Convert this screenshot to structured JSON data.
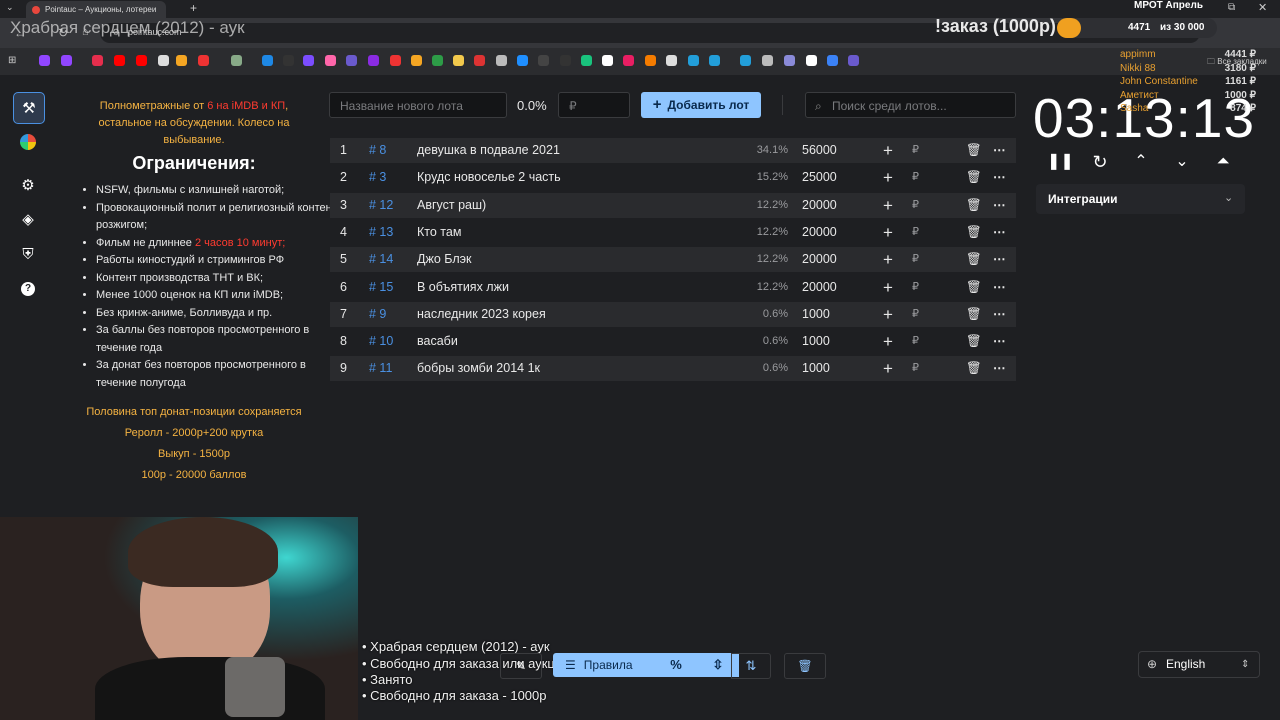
{
  "browser": {
    "tab_title": "Pointauc – Аукционы, лотереи",
    "url": "pointauc.com",
    "bookmarks_folder": "Все закладки"
  },
  "stream_overlay": {
    "title": "Храбрая сердцем (2012) - аук",
    "order_label": "!заказ (1000р)",
    "goal_label": "МРОТ Апрель",
    "goal_current": "4471",
    "goal_target": "из 30 000",
    "goal_progress": 0.149,
    "donors": [
      {
        "name": "appimm",
        "amount": "4441 ₽",
        "color": "#e8a030"
      },
      {
        "name": "Nikki 88",
        "amount": "3180 ₽",
        "color": "#e8a030"
      },
      {
        "name": "John Constantine",
        "amount": "1161 ₽",
        "color": "#e8a030"
      },
      {
        "name": "Аметист",
        "amount": "1000 ₽",
        "color": "#e8a030"
      },
      {
        "name": "Sasha",
        "amount": "874 ₽",
        "color": "#e8a030"
      }
    ],
    "bottom_lines": [
      "• Храбрая сердцем (2012) - аук",
      "• Свободно для заказа или аукциона",
      "• Занято",
      "• Свободно для заказа - 1000р"
    ]
  },
  "rules": {
    "intro_pre": "Полнометражные от ",
    "intro_red": "6 на iMDB и КП",
    "intro_post": ", остальное на обсуждении. Колесо на выбывание.",
    "heading": "Ограничения:",
    "items": [
      "NSFW, фильмы с излишней наготой;",
      "Провокационный полит и религиозный контент с розжигом;",
      "Фильм не длиннее ",
      "Работы киностудий и стримингов РФ",
      "Контент производства ТНТ и ВК;",
      "Менее 1000 оценок на КП или iMDB;",
      "Без кринж-аниме, Болливуда и пр.",
      "За баллы без повторов просмотренного в течение года",
      "За донат без повторов просмотренного в течение полугода"
    ],
    "item3_red": "2 часов 10 минут;",
    "footer": [
      "Половина топ донат-позиции сохраняется",
      "Реролл - 2000р+200 крутка",
      "Выкуп - 1500р",
      "100р - 20000 баллов"
    ]
  },
  "toolbar": {
    "lot_name_placeholder": "Название нового лота",
    "percent": "0.0%",
    "amount_placeholder": "₽",
    "add_button": "Добавить лот",
    "search_placeholder": "Поиск среди лотов..."
  },
  "lots": [
    {
      "pos": "1",
      "id": "# 8",
      "name": "девушка в подвале 2021",
      "pct": "34.1%",
      "amount": "56000"
    },
    {
      "pos": "2",
      "id": "# 3",
      "name": "Крудс новоселье 2 часть",
      "pct": "15.2%",
      "amount": "25000"
    },
    {
      "pos": "3",
      "id": "# 12",
      "name": "Август раш)",
      "pct": "12.2%",
      "amount": "20000"
    },
    {
      "pos": "4",
      "id": "# 13",
      "name": "Кто там",
      "pct": "12.2%",
      "amount": "20000"
    },
    {
      "pos": "5",
      "id": "# 14",
      "name": "Джо Блэк",
      "pct": "12.2%",
      "amount": "20000"
    },
    {
      "pos": "6",
      "id": "# 15",
      "name": "В объятиях лжи",
      "pct": "12.2%",
      "amount": "20000"
    },
    {
      "pos": "7",
      "id": "# 9",
      "name": "наследник 2023 корея",
      "pct": "0.6%",
      "amount": "1000"
    },
    {
      "pos": "8",
      "id": "# 10",
      "name": "васаби",
      "pct": "0.6%",
      "amount": "1000"
    },
    {
      "pos": "9",
      "id": "# 11",
      "name": "бобры зомби 2014 1к",
      "pct": "0.6%",
      "amount": "1000"
    }
  ],
  "lot_currency": "₽",
  "timer": "03:13:13",
  "integrations_label": "Интеграции",
  "bottom_toolbar": {
    "rules_label": "Правила"
  },
  "language": "English",
  "colors": {
    "accent": "#8ec5ff",
    "id_blue": "#4a90e2",
    "warning_red": "#ff3b30",
    "rules_orange": "#f5b342",
    "goal_orange": "#f0a020"
  }
}
